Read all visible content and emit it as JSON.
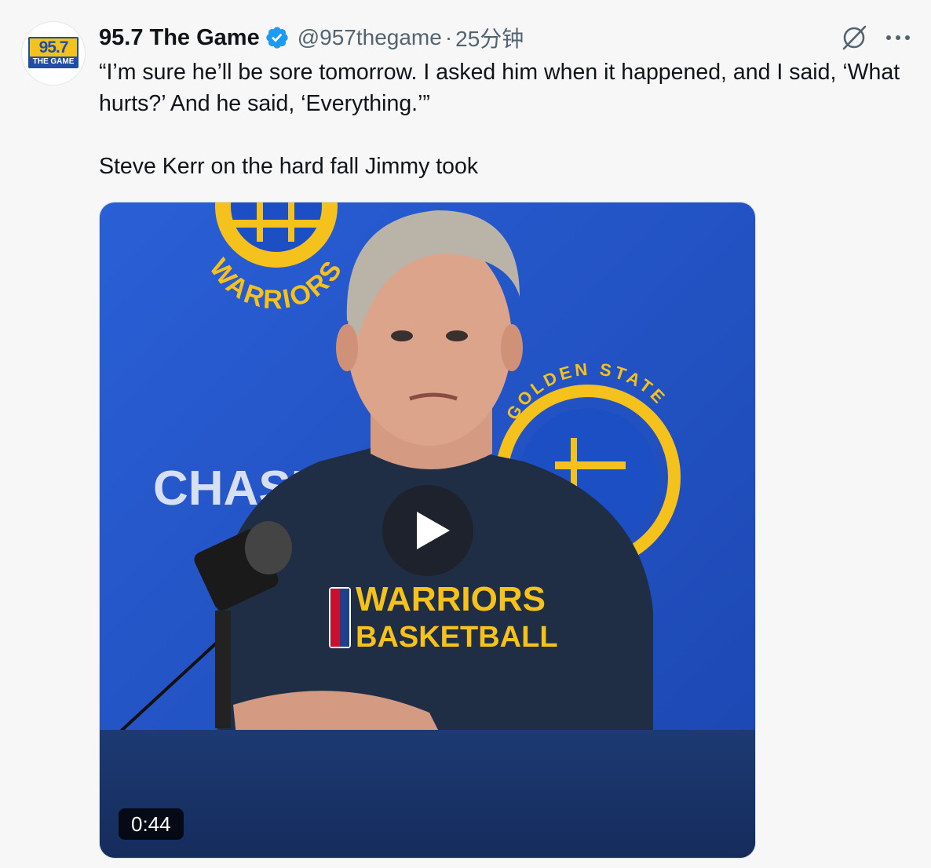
{
  "tweet": {
    "avatar": {
      "logo_number": "95.7",
      "logo_subtitle": "THE GAME",
      "brand_blue": "#1f4ea3",
      "brand_yellow": "#f5c21d"
    },
    "author": {
      "display_name": "95.7 The Game",
      "verified_icon": "verified-badge-icon",
      "handle": "@957thegame",
      "separator": "·",
      "time": "25分钟"
    },
    "actions": {
      "grok_icon": "grok-icon",
      "more_icon": "more-icon"
    },
    "text": {
      "quote_line": "“I’m sure he’ll be sore tomorrow. I asked him when it happened, and I said, ‘What hurts?’ And he said, ‘Everything.’”",
      "caption_line": "Steve Kerr on the hard fall Jimmy took"
    },
    "media": {
      "type": "video",
      "backdrop_top_logo": "WARRIORS",
      "backdrop_sponsor": "CHASE",
      "backdrop_right_logo": "GOLDEN STATE",
      "shirt_line_1": "WARRIORS",
      "shirt_line_2": "BASKETBALL",
      "play_icon": "play-icon",
      "duration": "0:44",
      "backdrop_color": "#1d4fc4",
      "gold_color": "#f5c21d"
    }
  }
}
